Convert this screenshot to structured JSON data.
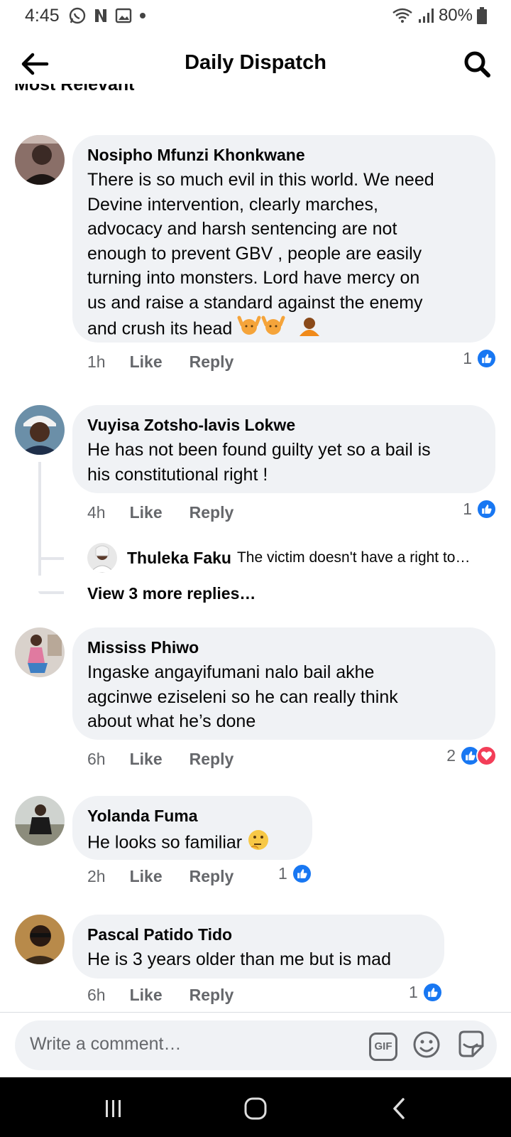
{
  "status_bar": {
    "time": "4:45",
    "battery": "80%"
  },
  "header": {
    "title": "Daily Dispatch"
  },
  "sort": {
    "label": "Most Relevant"
  },
  "comments": [
    {
      "author": "Nosipho Mfunzi Khonkwane",
      "lines": [
        "There is so much evil in this world.  We need",
        "Devine intervention,  clearly marches,",
        "advocacy  and harsh sentencing are not",
        "enough to prevent GBV ,   people are easily",
        "turning into monsters. Lord have mercy on",
        "us and raise a standard against the enemy",
        "and crush its head"
      ],
      "time": "1h",
      "like_label": "Like",
      "reply_label": "Reply",
      "reaction_count": "1"
    },
    {
      "author": "Vuyisa Zotsho-lavis Lokwe",
      "lines": [
        "He has not been found guilty yet so a bail is",
        "his constitutional right !"
      ],
      "time": "4h",
      "like_label": "Like",
      "reply_label": "Reply",
      "reaction_count": "1"
    },
    {
      "author": "Mississ Phiwo",
      "lines": [
        "Ingaske angayifumani nalo bail akhe",
        "agcinwe eziseleni so he can really think",
        "about what he’s done"
      ],
      "time": "6h",
      "like_label": "Like",
      "reply_label": "Reply",
      "reaction_count": "2"
    },
    {
      "author": "Yolanda Fuma",
      "lines": [
        "He looks so familiar"
      ],
      "time": "2h",
      "like_label": "Like",
      "reply_label": "Reply",
      "reaction_count": "1"
    },
    {
      "author": "Pascal Patido Tido",
      "lines": [
        "He is 3 years older than me but is mad"
      ],
      "time": "6h",
      "like_label": "Like",
      "reply_label": "Reply",
      "reaction_count": "1"
    }
  ],
  "reply_preview": {
    "author": "Thuleka Faku",
    "text": "The victim doesn't have a right to…",
    "view_more": "View 3 more replies…"
  },
  "composer": {
    "placeholder": "Write a comment…",
    "gif_label": "GIF"
  },
  "colors": {
    "bubble": "#f0f2f5",
    "like_blue": "#1877f2",
    "love_red": "#f33e58",
    "meta_gray": "#65676b"
  }
}
